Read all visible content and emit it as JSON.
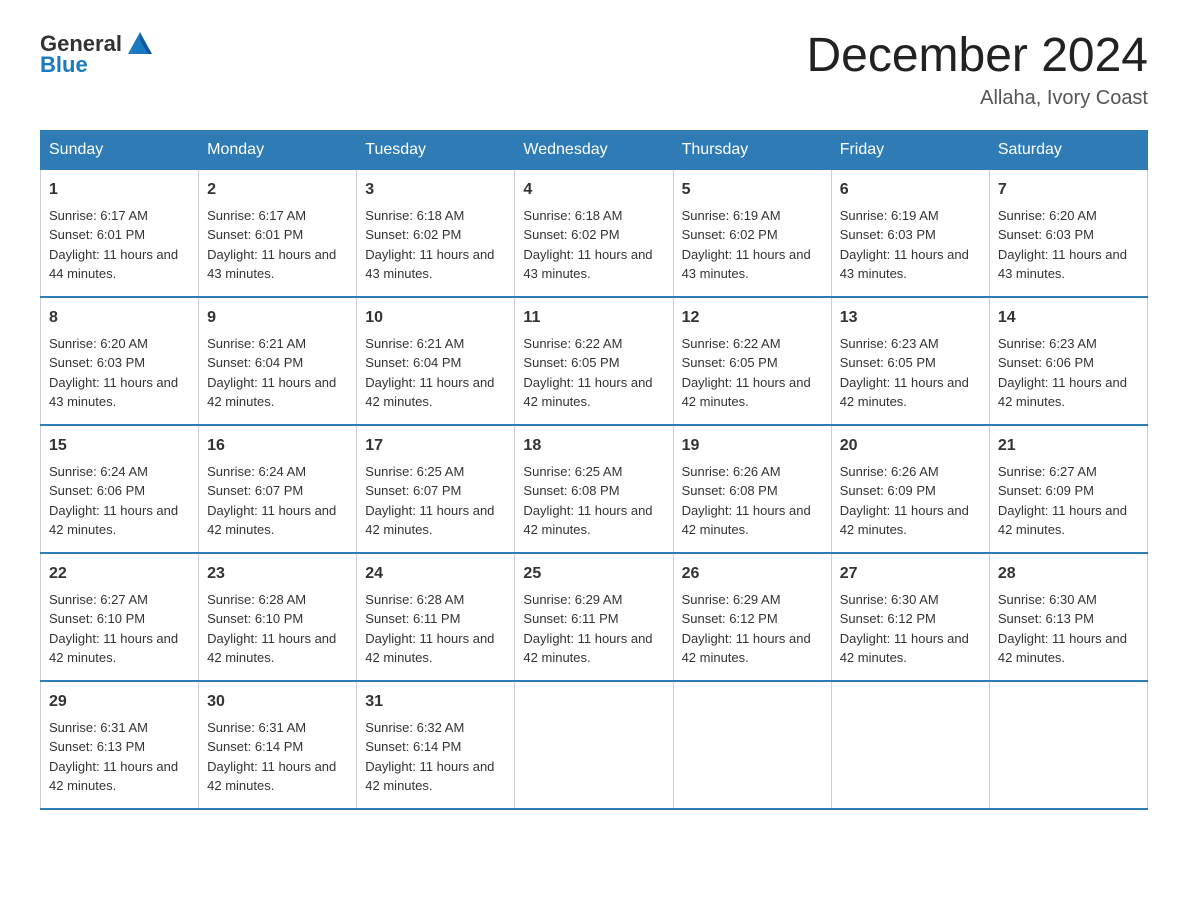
{
  "logo": {
    "text_general": "General",
    "text_blue": "Blue"
  },
  "title": "December 2024",
  "subtitle": "Allaha, Ivory Coast",
  "days_of_week": [
    "Sunday",
    "Monday",
    "Tuesday",
    "Wednesday",
    "Thursday",
    "Friday",
    "Saturday"
  ],
  "weeks": [
    [
      {
        "day": "1",
        "sunrise": "6:17 AM",
        "sunset": "6:01 PM",
        "daylight": "11 hours and 44 minutes."
      },
      {
        "day": "2",
        "sunrise": "6:17 AM",
        "sunset": "6:01 PM",
        "daylight": "11 hours and 43 minutes."
      },
      {
        "day": "3",
        "sunrise": "6:18 AM",
        "sunset": "6:02 PM",
        "daylight": "11 hours and 43 minutes."
      },
      {
        "day": "4",
        "sunrise": "6:18 AM",
        "sunset": "6:02 PM",
        "daylight": "11 hours and 43 minutes."
      },
      {
        "day": "5",
        "sunrise": "6:19 AM",
        "sunset": "6:02 PM",
        "daylight": "11 hours and 43 minutes."
      },
      {
        "day": "6",
        "sunrise": "6:19 AM",
        "sunset": "6:03 PM",
        "daylight": "11 hours and 43 minutes."
      },
      {
        "day": "7",
        "sunrise": "6:20 AM",
        "sunset": "6:03 PM",
        "daylight": "11 hours and 43 minutes."
      }
    ],
    [
      {
        "day": "8",
        "sunrise": "6:20 AM",
        "sunset": "6:03 PM",
        "daylight": "11 hours and 43 minutes."
      },
      {
        "day": "9",
        "sunrise": "6:21 AM",
        "sunset": "6:04 PM",
        "daylight": "11 hours and 42 minutes."
      },
      {
        "day": "10",
        "sunrise": "6:21 AM",
        "sunset": "6:04 PM",
        "daylight": "11 hours and 42 minutes."
      },
      {
        "day": "11",
        "sunrise": "6:22 AM",
        "sunset": "6:05 PM",
        "daylight": "11 hours and 42 minutes."
      },
      {
        "day": "12",
        "sunrise": "6:22 AM",
        "sunset": "6:05 PM",
        "daylight": "11 hours and 42 minutes."
      },
      {
        "day": "13",
        "sunrise": "6:23 AM",
        "sunset": "6:05 PM",
        "daylight": "11 hours and 42 minutes."
      },
      {
        "day": "14",
        "sunrise": "6:23 AM",
        "sunset": "6:06 PM",
        "daylight": "11 hours and 42 minutes."
      }
    ],
    [
      {
        "day": "15",
        "sunrise": "6:24 AM",
        "sunset": "6:06 PM",
        "daylight": "11 hours and 42 minutes."
      },
      {
        "day": "16",
        "sunrise": "6:24 AM",
        "sunset": "6:07 PM",
        "daylight": "11 hours and 42 minutes."
      },
      {
        "day": "17",
        "sunrise": "6:25 AM",
        "sunset": "6:07 PM",
        "daylight": "11 hours and 42 minutes."
      },
      {
        "day": "18",
        "sunrise": "6:25 AM",
        "sunset": "6:08 PM",
        "daylight": "11 hours and 42 minutes."
      },
      {
        "day": "19",
        "sunrise": "6:26 AM",
        "sunset": "6:08 PM",
        "daylight": "11 hours and 42 minutes."
      },
      {
        "day": "20",
        "sunrise": "6:26 AM",
        "sunset": "6:09 PM",
        "daylight": "11 hours and 42 minutes."
      },
      {
        "day": "21",
        "sunrise": "6:27 AM",
        "sunset": "6:09 PM",
        "daylight": "11 hours and 42 minutes."
      }
    ],
    [
      {
        "day": "22",
        "sunrise": "6:27 AM",
        "sunset": "6:10 PM",
        "daylight": "11 hours and 42 minutes."
      },
      {
        "day": "23",
        "sunrise": "6:28 AM",
        "sunset": "6:10 PM",
        "daylight": "11 hours and 42 minutes."
      },
      {
        "day": "24",
        "sunrise": "6:28 AM",
        "sunset": "6:11 PM",
        "daylight": "11 hours and 42 minutes."
      },
      {
        "day": "25",
        "sunrise": "6:29 AM",
        "sunset": "6:11 PM",
        "daylight": "11 hours and 42 minutes."
      },
      {
        "day": "26",
        "sunrise": "6:29 AM",
        "sunset": "6:12 PM",
        "daylight": "11 hours and 42 minutes."
      },
      {
        "day": "27",
        "sunrise": "6:30 AM",
        "sunset": "6:12 PM",
        "daylight": "11 hours and 42 minutes."
      },
      {
        "day": "28",
        "sunrise": "6:30 AM",
        "sunset": "6:13 PM",
        "daylight": "11 hours and 42 minutes."
      }
    ],
    [
      {
        "day": "29",
        "sunrise": "6:31 AM",
        "sunset": "6:13 PM",
        "daylight": "11 hours and 42 minutes."
      },
      {
        "day": "30",
        "sunrise": "6:31 AM",
        "sunset": "6:14 PM",
        "daylight": "11 hours and 42 minutes."
      },
      {
        "day": "31",
        "sunrise": "6:32 AM",
        "sunset": "6:14 PM",
        "daylight": "11 hours and 42 minutes."
      },
      null,
      null,
      null,
      null
    ]
  ]
}
